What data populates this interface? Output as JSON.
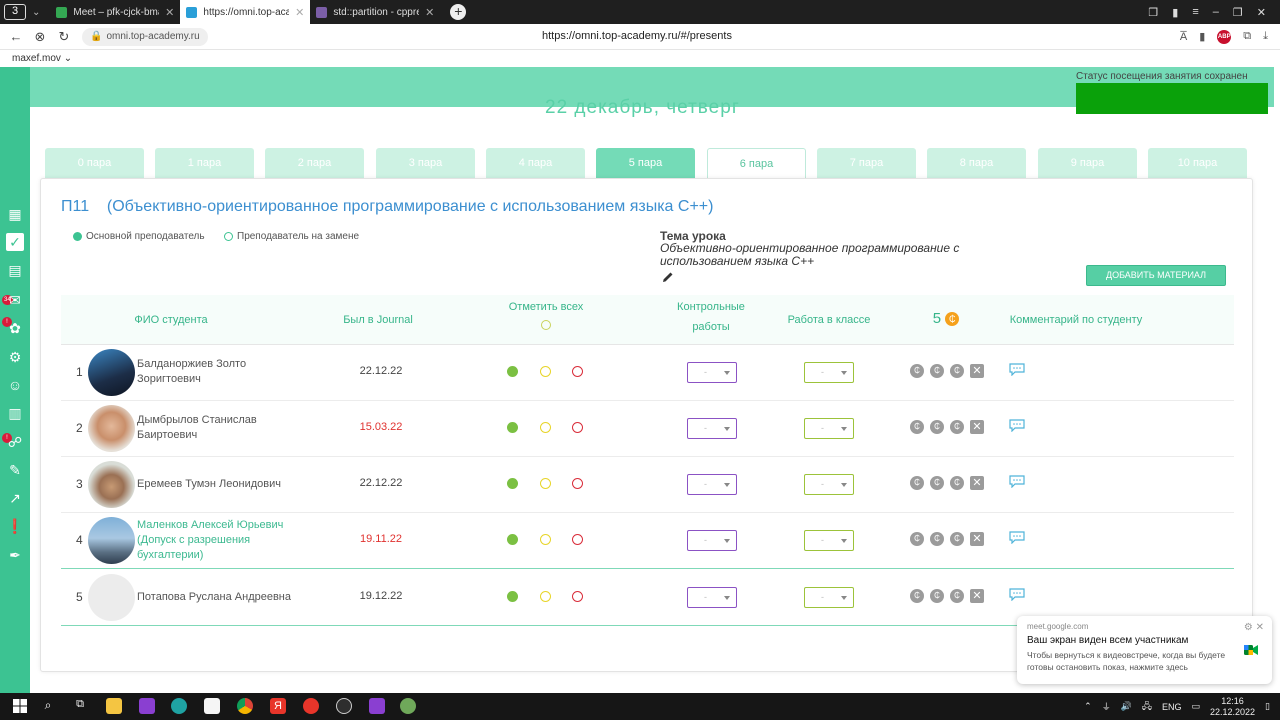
{
  "browser": {
    "tabs": [
      {
        "title": "Meet – pfk-cjck-bma",
        "active": false,
        "color": "#34a853"
      },
      {
        "title": "https://omni.top-academ",
        "active": true,
        "color": "#2a9fd8"
      },
      {
        "title": "std::partition - cppreferen",
        "active": false,
        "color": "#7b5ea7"
      }
    ],
    "tab_count": "3",
    "site_pill": "omni.top-academy.ru",
    "url": "https://omni.top-academy.ru/#/presents",
    "bookmark": "maxef.mov"
  },
  "header": {
    "date_title": "22 декабрь, четверг",
    "saved_message": "Статус посещения занятия сохранен"
  },
  "pairs": [
    "0 пара",
    "1 пара",
    "2 пара",
    "3 пара",
    "4 пара",
    "5 пара",
    "6 пара",
    "7 пара",
    "8 пара",
    "9 пара",
    "10 пара"
  ],
  "active_pair": "6 пара",
  "done_pair": "5 пара",
  "lesson": {
    "group": "П11",
    "subject": "(Объективно-ориентированное программирование с использованием языка С++)",
    "legend_main": "Основной преподаватель",
    "legend_sub": "Преподаватель на замене",
    "topic_label": "Тема урока",
    "topic_text": "Объективно-ориентированное программирование с использованием языка С++",
    "add_material": "ДОБАВИТЬ МАТЕРИАЛ"
  },
  "table": {
    "headers": {
      "name": "ФИО студента",
      "journal": "Был в Journal",
      "mark_all": "Отметить всех",
      "tests": "Контрольные работы",
      "classwork": "Работа в классе",
      "coins": "5",
      "comment": "Комментарий по студенту"
    },
    "rows": [
      {
        "num": "1",
        "name": "Балданоржиев Золто Зоригтоевич",
        "date": "22.12.22",
        "late": false,
        "link": false
      },
      {
        "num": "2",
        "name": "Дымбрылов Станислав Баиртоевич",
        "date": "15.03.22",
        "late": true,
        "link": false
      },
      {
        "num": "3",
        "name": "Еремеев Тумэн Леонидович",
        "date": "22.12.22",
        "late": false,
        "link": false
      },
      {
        "num": "4",
        "name": "Маленков Алексей Юрьевич (Допуск с разрешения бухгалтерии)",
        "date": "19.11.22",
        "late": true,
        "link": true
      },
      {
        "num": "5",
        "name": "Потапова Руслана Андреевна",
        "date": "19.12.22",
        "late": false,
        "link": false
      }
    ],
    "select_placeholder": "-"
  },
  "meet_notification": {
    "source": "meet.google.com",
    "title": "Ваш экран виден всем участникам",
    "body": "Чтобы вернуться к видеовстрече, когда вы будете готовы остановить показ, нажмите здесь"
  },
  "taskbar": {
    "lang": "ENG",
    "time": "12:16",
    "date": "22.12.2022"
  },
  "colors": {
    "accent": "#3cc392",
    "band": "#74dbb7",
    "saved": "#0aa10a",
    "late_date": "#e0322f"
  }
}
